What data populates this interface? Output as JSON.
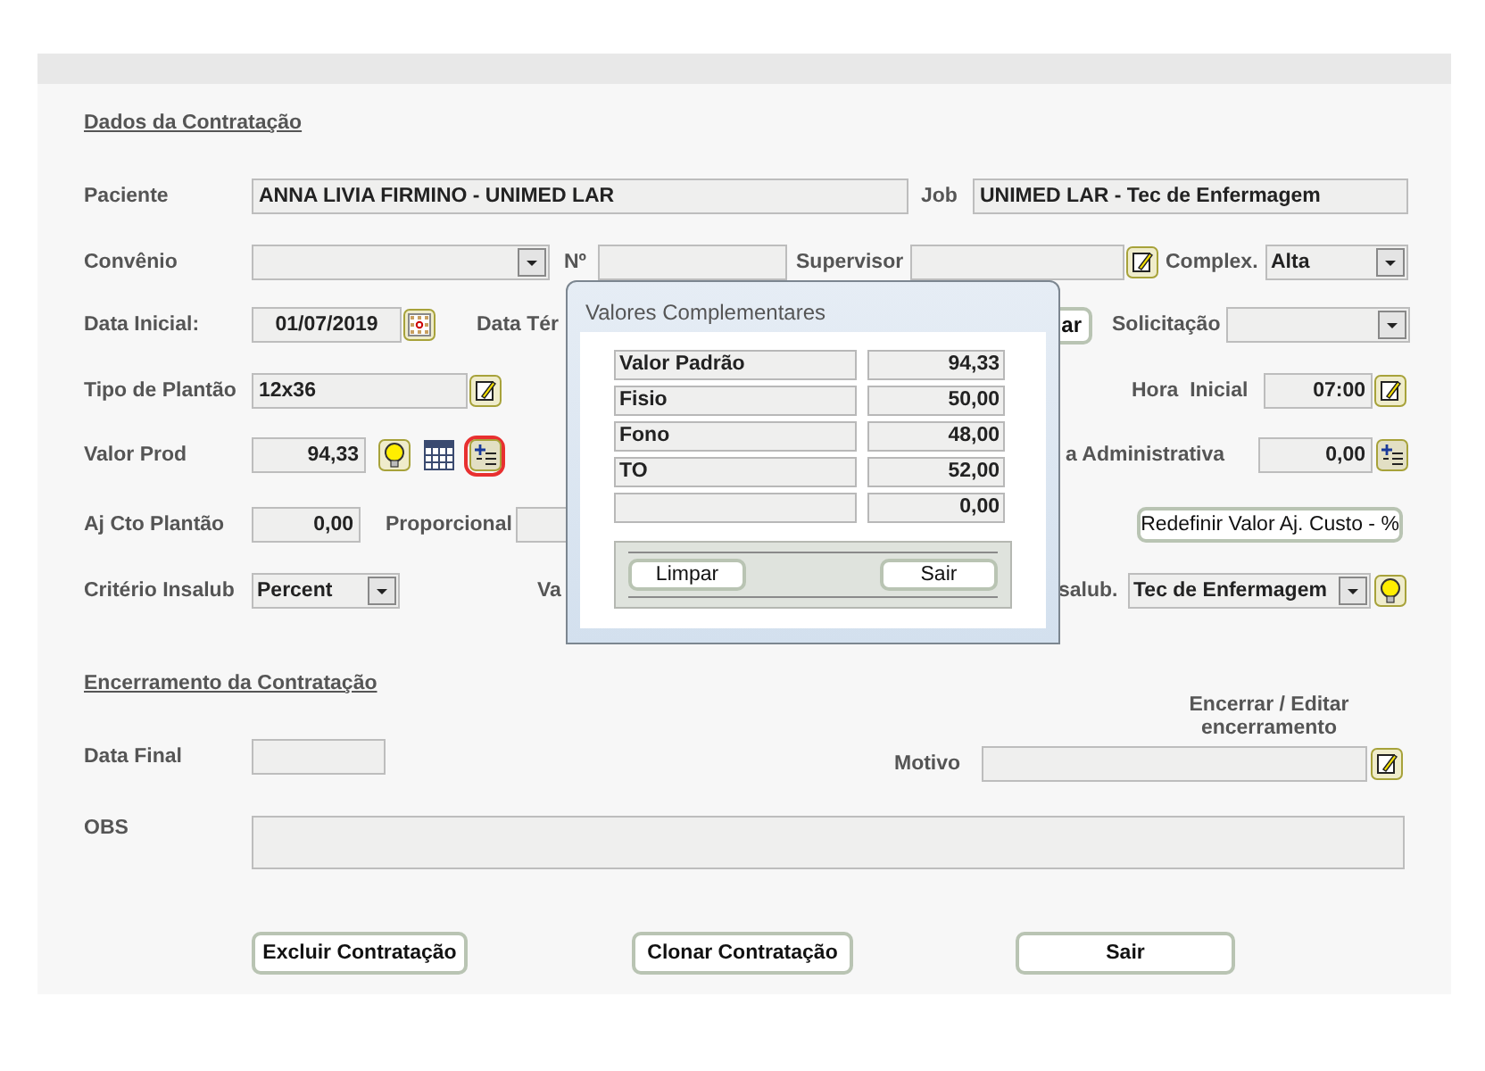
{
  "dados": {
    "title": "Dados da Contratação",
    "paciente_label": "Paciente",
    "paciente": "ANNA LIVIA FIRMINO - UNIMED LAR",
    "job_label": "Job",
    "job": "UNIMED LAR - Tec de Enfermagem",
    "convenio_label": "Convênio",
    "numero_label": "Nº",
    "supervisor_label": "Supervisor",
    "complex_label": "Complex.",
    "complex": "Alta",
    "data_inicial_label": "Data Inicial:",
    "data_inicial": "01/07/2019",
    "data_termino_label": "Data Tér",
    "partial_button": "ar",
    "solicitacao_label": "Solicitação",
    "tipo_plantao_label": "Tipo de Plantão",
    "tipo_plantao": "12x36",
    "hora_inicial_label": "Hora  Inicial",
    "hora_inicial": "07:00",
    "valor_prod_label": "Valor Prod",
    "valor_prod": "94,33",
    "valor_prod_action_focused": true,
    "taxa_label": "a Administrativa",
    "taxa": "0,00",
    "aj_cto_label": "Aj Cto Plantão",
    "aj_cto": "0,00",
    "proporcional_label": "Proporcional",
    "redefinir_button": "Redefinir Valor Aj. Custo - %",
    "criterio_label": "Critério Insalub",
    "criterio": "Percent",
    "valor_insalub_label": "Va",
    "insalub_label": "salub.",
    "insalub": "Tec de Enfermagem"
  },
  "encerramento": {
    "title": "Encerramento da Contratação",
    "editar_label": "Encerrar / Editar encerramento",
    "data_final_label": "Data Final",
    "motivo_label": "Motivo",
    "obs_label": "OBS"
  },
  "buttons": [
    "Excluir Contratação",
    "Clonar Contratação",
    "Sair"
  ],
  "dialog": {
    "title": "Valores Complementares",
    "rows": [
      {
        "label": "Valor Padrão",
        "value": "94,33"
      },
      {
        "label": "Fisio",
        "value": "50,00"
      },
      {
        "label": "Fono",
        "value": "48,00"
      },
      {
        "label": "TO",
        "value": "52,00"
      },
      {
        "value": "0,00"
      }
    ],
    "buttons": [
      "Limpar",
      "Sair"
    ]
  }
}
